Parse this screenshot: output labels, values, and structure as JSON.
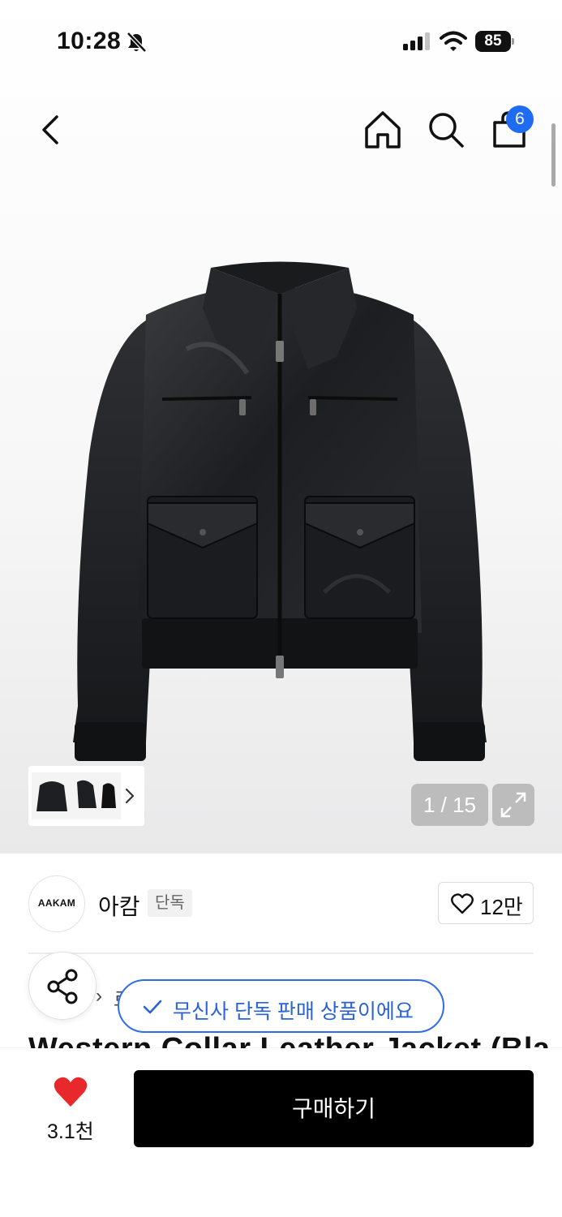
{
  "status_bar": {
    "time": "10:28",
    "battery": "85"
  },
  "header": {
    "cart_count": "6"
  },
  "gallery": {
    "counter": "1 / 15"
  },
  "brand": {
    "logo_text": "AAKAM",
    "name": "아캄",
    "tag": "단독",
    "likes": "12만"
  },
  "breadcrumb": {
    "peek_text": "로"
  },
  "product": {
    "title": "Western Collar Leather Jacket (Bla"
  },
  "toast": {
    "message": "무신사 단독 판매 상품이에요"
  },
  "bottom_bar": {
    "wish_count": "3.1천",
    "buy_label": "구매하기"
  },
  "colors": {
    "accent_blue": "#1f6bf2",
    "heart_red": "#e8282b",
    "buy_button": "#000000"
  },
  "icons": [
    "bell-off-icon",
    "signal-icon",
    "wifi-icon",
    "battery-icon",
    "back-icon",
    "home-icon",
    "search-icon",
    "shopping-bag-icon",
    "chevron-right-icon",
    "expand-icon",
    "heart-outline-icon",
    "share-icon",
    "check-icon",
    "heart-filled-icon"
  ]
}
